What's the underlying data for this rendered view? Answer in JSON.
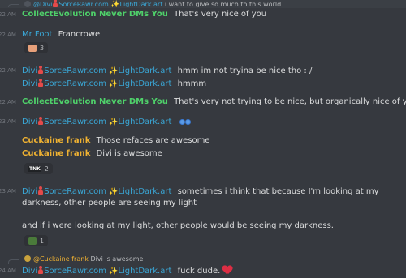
{
  "reply_top": {
    "author": "Divi",
    "author_suffix": "SorceRawr.com",
    "author_suffix2": "LightDark.art",
    "text": "i want to give so much to this world"
  },
  "messages": [
    {
      "ts": "22 AM",
      "author": "CollectEvolution Never DMs You",
      "text": "That's very nice of you"
    },
    {
      "ts": "22 AM",
      "author": "Mr Foot",
      "text": "Francrowe"
    },
    {
      "reaction_count": "3"
    },
    {
      "ts": "22 AM",
      "author_a": "Divi",
      "author_b": "SorceRawr.com",
      "author_c": "LightDark.art",
      "text": "hmm im not tryina be nice tho : /"
    },
    {
      "author_a": "Divi",
      "author_b": "SorceRawr.com",
      "author_c": "LightDark.art",
      "text": "hmmm"
    },
    {
      "ts": "22 AM",
      "author": "CollectEvolution Never DMs You",
      "text": "That's very not trying to be nice, but organically nice of you"
    },
    {
      "ts": "23 AM",
      "author_a": "Divi",
      "author_b": "SorceRawr.com",
      "author_c": "LightDark.art",
      "text": ""
    },
    {
      "ts": "",
      "author": "Cuckaine frank",
      "text": "Those refaces are awesome"
    },
    {
      "author": "Cuckaine frank",
      "text": "Divi is awesome"
    },
    {
      "reaction_count": "2",
      "reaction_emoji": "TNK"
    },
    {
      "ts": "23 AM",
      "author_a": "Divi",
      "author_b": "SorceRawr.com",
      "author_c": "LightDark.art",
      "text_line1": "sometimes i think that because I'm looking at my",
      "text_line2": "darkness, other people are seeing my light",
      "text_line3": "and if i were looking at my light, other people would be seeing my darkness."
    },
    {
      "reaction_count": "1"
    },
    {
      "reply_author": "@Cuckaine frank",
      "reply_text": "Divi is awesome"
    },
    {
      "ts": "24 AM",
      "author_a": "Divi",
      "author_b": "SorceRawr.com",
      "author_c": "LightDark.art",
      "text": "fuck dude."
    }
  ],
  "colors": {
    "background": "#36393f",
    "green": "#4fd16a",
    "blue": "#3aa7d6",
    "gold": "#f0b232",
    "text": "#dcddde"
  }
}
